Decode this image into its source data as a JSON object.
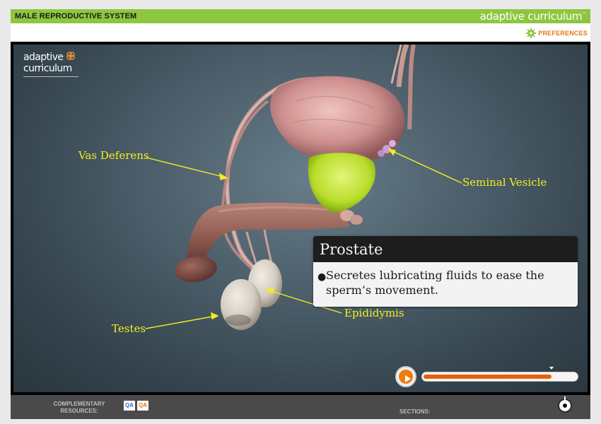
{
  "header": {
    "title": "MALE REPRODUCTIVE SYSTEM",
    "brand": "adaptive curriculum",
    "preferences_label": "PREFERENCES"
  },
  "logo": {
    "line1": "adaptive",
    "line2": "curriculum"
  },
  "callouts": {
    "vas_deferens": "Vas Deferens",
    "seminal_vesicle": "Seminal Vesicle",
    "testes": "Testes",
    "epididymis": "Epididymis"
  },
  "info_box": {
    "title": "Prostate",
    "bullet_line1": "Secretes lubricating fluids to ease the",
    "bullet_line2": "sperm’s movement."
  },
  "player": {
    "progress": 0.83
  },
  "footer": {
    "resources_label_line1": "COMPLEMENTARY",
    "resources_label_line2": "RESOURCES:",
    "qa1": "QA",
    "qa2": "QA",
    "sections_label": "SECTIONS:"
  },
  "colors": {
    "accent_green": "#8dc63f",
    "accent_orange": "#e8730e",
    "callout_yellow": "#f2ee1f"
  },
  "icons": [
    "gear-icon",
    "play-icon",
    "section-dial-icon"
  ]
}
